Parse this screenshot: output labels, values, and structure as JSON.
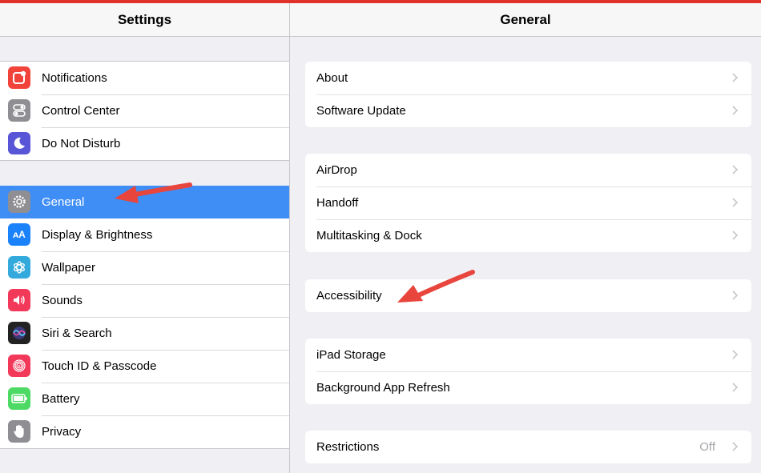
{
  "left": {
    "title": "Settings",
    "groups": [
      {
        "items": [
          {
            "label": "Notifications",
            "icon": "notifications-icon",
            "color": "#f2433a"
          },
          {
            "label": "Control Center",
            "icon": "control-center-icon",
            "color": "#8e8e93"
          },
          {
            "label": "Do Not Disturb",
            "icon": "moon-icon",
            "color": "#5856d6"
          }
        ]
      },
      {
        "items": [
          {
            "label": "General",
            "icon": "gear-icon",
            "color": "#8e8e93",
            "selected": true
          },
          {
            "label": "Display & Brightness",
            "icon": "display-icon",
            "color": "#1a82fb"
          },
          {
            "label": "Wallpaper",
            "icon": "wallpaper-icon",
            "color": "#34aadc"
          },
          {
            "label": "Sounds",
            "icon": "sounds-icon",
            "color": "#f2395a"
          },
          {
            "label": "Siri & Search",
            "icon": "siri-icon",
            "color": "#222222"
          },
          {
            "label": "Touch ID & Passcode",
            "icon": "fingerprint-icon",
            "color": "#f2395a"
          },
          {
            "label": "Battery",
            "icon": "battery-icon",
            "color": "#4cd964"
          },
          {
            "label": "Privacy",
            "icon": "hand-icon",
            "color": "#8e8e93"
          }
        ]
      }
    ]
  },
  "right": {
    "title": "General",
    "groups": [
      {
        "items": [
          {
            "label": "About"
          },
          {
            "label": "Software Update"
          }
        ]
      },
      {
        "items": [
          {
            "label": "AirDrop"
          },
          {
            "label": "Handoff"
          },
          {
            "label": "Multitasking & Dock"
          }
        ]
      },
      {
        "items": [
          {
            "label": "Accessibility"
          }
        ]
      },
      {
        "items": [
          {
            "label": "iPad Storage"
          },
          {
            "label": "Background App Refresh"
          }
        ]
      },
      {
        "items": [
          {
            "label": "Restrictions",
            "value": "Off"
          }
        ]
      }
    ]
  },
  "colors": {
    "selected": "#3f8ef5",
    "annotation_arrow": "#e8453c",
    "top_bar": "#e0312b"
  }
}
